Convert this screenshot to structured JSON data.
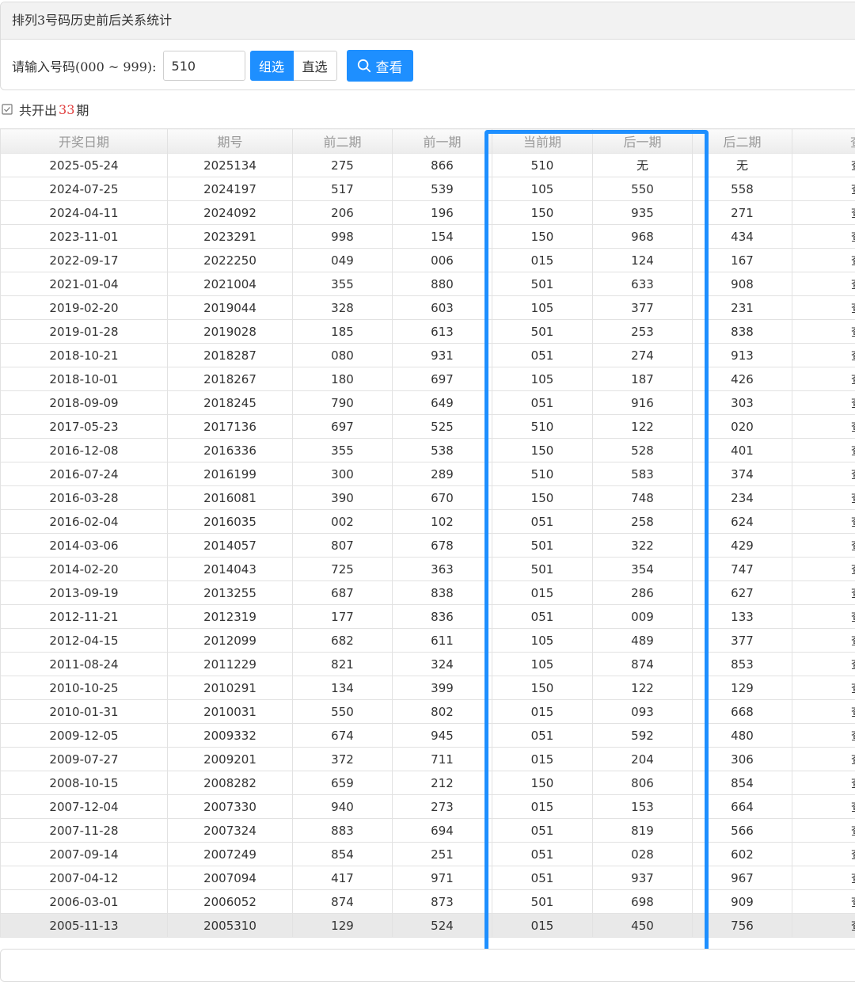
{
  "header": {
    "title": "排列3号码历史前后关系统计"
  },
  "form": {
    "label": "请输入号码(000 ~ 999):",
    "input_value": "510",
    "group_label": "组选",
    "direct_label": "直选",
    "query_label": "查看"
  },
  "summary": {
    "prefix": "共开出",
    "count": "33",
    "suffix": "期"
  },
  "table": {
    "headers": [
      "开奖日期",
      "期号",
      "前二期",
      "前一期",
      "当前期",
      "后一期",
      "后二期",
      "查"
    ],
    "view_label": "查",
    "rows": [
      [
        "2025-05-24",
        "2025134",
        "275",
        "866",
        "510",
        "无",
        "无"
      ],
      [
        "2024-07-25",
        "2024197",
        "517",
        "539",
        "105",
        "550",
        "558"
      ],
      [
        "2024-04-11",
        "2024092",
        "206",
        "196",
        "150",
        "935",
        "271"
      ],
      [
        "2023-11-01",
        "2023291",
        "998",
        "154",
        "150",
        "968",
        "434"
      ],
      [
        "2022-09-17",
        "2022250",
        "049",
        "006",
        "015",
        "124",
        "167"
      ],
      [
        "2021-01-04",
        "2021004",
        "355",
        "880",
        "501",
        "633",
        "908"
      ],
      [
        "2019-02-20",
        "2019044",
        "328",
        "603",
        "105",
        "377",
        "231"
      ],
      [
        "2019-01-28",
        "2019028",
        "185",
        "613",
        "501",
        "253",
        "838"
      ],
      [
        "2018-10-21",
        "2018287",
        "080",
        "931",
        "051",
        "274",
        "913"
      ],
      [
        "2018-10-01",
        "2018267",
        "180",
        "697",
        "105",
        "187",
        "426"
      ],
      [
        "2018-09-09",
        "2018245",
        "790",
        "649",
        "051",
        "916",
        "303"
      ],
      [
        "2017-05-23",
        "2017136",
        "697",
        "525",
        "510",
        "122",
        "020"
      ],
      [
        "2016-12-08",
        "2016336",
        "355",
        "538",
        "150",
        "528",
        "401"
      ],
      [
        "2016-07-24",
        "2016199",
        "300",
        "289",
        "510",
        "583",
        "374"
      ],
      [
        "2016-03-28",
        "2016081",
        "390",
        "670",
        "150",
        "748",
        "234"
      ],
      [
        "2016-02-04",
        "2016035",
        "002",
        "102",
        "051",
        "258",
        "624"
      ],
      [
        "2014-03-06",
        "2014057",
        "807",
        "678",
        "501",
        "322",
        "429"
      ],
      [
        "2014-02-20",
        "2014043",
        "725",
        "363",
        "501",
        "354",
        "747"
      ],
      [
        "2013-09-19",
        "2013255",
        "687",
        "838",
        "015",
        "286",
        "627"
      ],
      [
        "2012-11-21",
        "2012319",
        "177",
        "836",
        "051",
        "009",
        "133"
      ],
      [
        "2012-04-15",
        "2012099",
        "682",
        "611",
        "105",
        "489",
        "377"
      ],
      [
        "2011-08-24",
        "2011229",
        "821",
        "324",
        "105",
        "874",
        "853"
      ],
      [
        "2010-10-25",
        "2010291",
        "134",
        "399",
        "150",
        "122",
        "129"
      ],
      [
        "2010-01-31",
        "2010031",
        "550",
        "802",
        "015",
        "093",
        "668"
      ],
      [
        "2009-12-05",
        "2009332",
        "674",
        "945",
        "051",
        "592",
        "480"
      ],
      [
        "2009-07-27",
        "2009201",
        "372",
        "711",
        "015",
        "204",
        "306"
      ],
      [
        "2008-10-15",
        "2008282",
        "659",
        "212",
        "150",
        "806",
        "854"
      ],
      [
        "2007-12-04",
        "2007330",
        "940",
        "273",
        "015",
        "153",
        "664"
      ],
      [
        "2007-11-28",
        "2007324",
        "883",
        "694",
        "051",
        "819",
        "566"
      ],
      [
        "2007-09-14",
        "2007249",
        "854",
        "251",
        "051",
        "028",
        "602"
      ],
      [
        "2007-04-12",
        "2007094",
        "417",
        "971",
        "051",
        "937",
        "967"
      ],
      [
        "2006-03-01",
        "2006052",
        "874",
        "873",
        "501",
        "698",
        "909"
      ],
      [
        "2005-11-13",
        "2005310",
        "129",
        "524",
        "015",
        "450",
        "756"
      ]
    ]
  },
  "colors": {
    "accent": "#1e8fff",
    "count": "#e03e3e"
  }
}
